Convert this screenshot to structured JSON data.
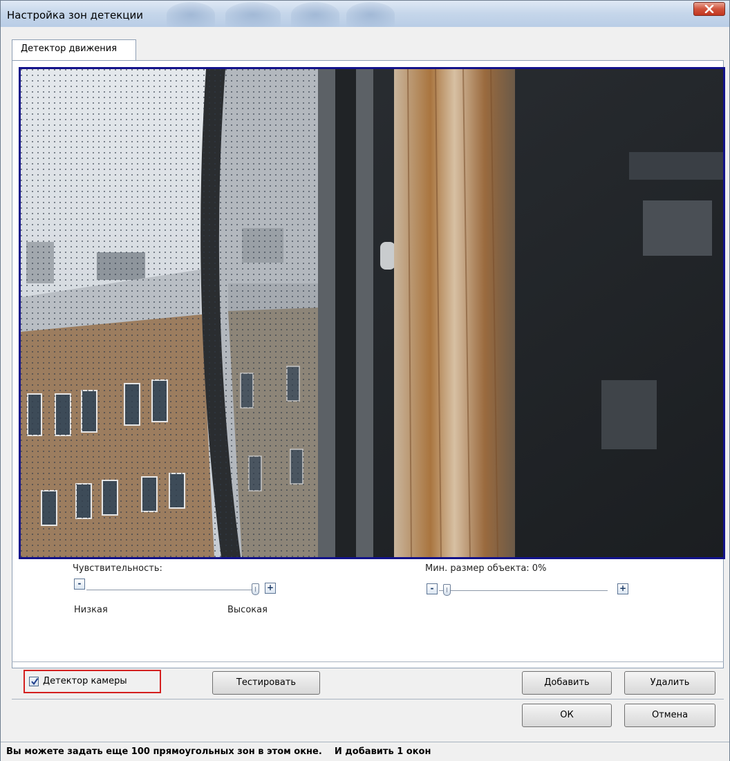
{
  "window": {
    "title": "Настройка зон детекции"
  },
  "tabs": [
    {
      "label": "Детектор движения",
      "active": true
    }
  ],
  "sensitivity": {
    "label": "Чувствительность:",
    "min_label": "Низкая",
    "max_label": "Высокая",
    "minus": "-",
    "plus": "+",
    "value_fraction": 1.0
  },
  "min_object": {
    "label": "Мин. размер объекта: 0%",
    "minus": "-",
    "plus": "+",
    "value_fraction": 0.0
  },
  "camera_detector": {
    "label": "Детектор камеры",
    "checked": true
  },
  "buttons": {
    "test": "Тестировать",
    "add": "Добавить",
    "delete": "Удалить",
    "ok": "ОК",
    "cancel": "Отмена"
  },
  "status": {
    "message": "Вы можете задать еще 100 прямоугольных зон в этом окне.    И добавить 1 окон"
  },
  "colors": {
    "zone_border": "#12128a",
    "highlight": "#d41f1f",
    "close_button": "#c2361f"
  }
}
